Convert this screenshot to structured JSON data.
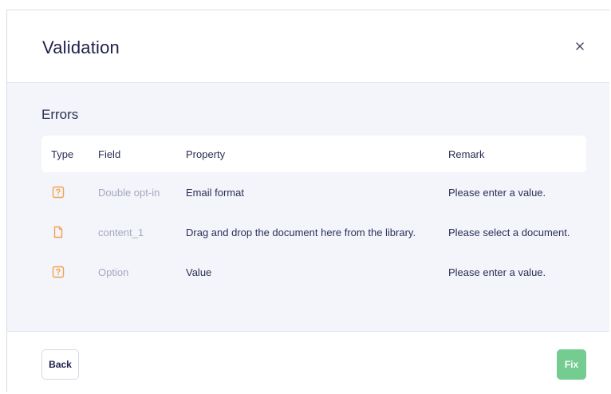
{
  "dialog": {
    "title": "Validation",
    "close_icon": "close-icon"
  },
  "errors": {
    "section_title": "Errors",
    "columns": {
      "type": "Type",
      "field": "Field",
      "property": "Property",
      "remark": "Remark"
    },
    "rows": [
      {
        "type_icon": "question-box-icon",
        "field": "Double opt-in",
        "property": "Email format",
        "remark": "Please enter a value."
      },
      {
        "type_icon": "document-icon",
        "field": "content_1",
        "property": "Drag and drop the document here from the library.",
        "remark": "Please select a document."
      },
      {
        "type_icon": "question-box-icon",
        "field": "Option",
        "property": "Value",
        "remark": "Please enter a value."
      }
    ]
  },
  "footer": {
    "back_label": "Back",
    "fix_label": "Fix"
  },
  "colors": {
    "accent_icon": "#f0a24e",
    "fix_button": "#74cc91",
    "body_bg": "#f4f5fb"
  }
}
